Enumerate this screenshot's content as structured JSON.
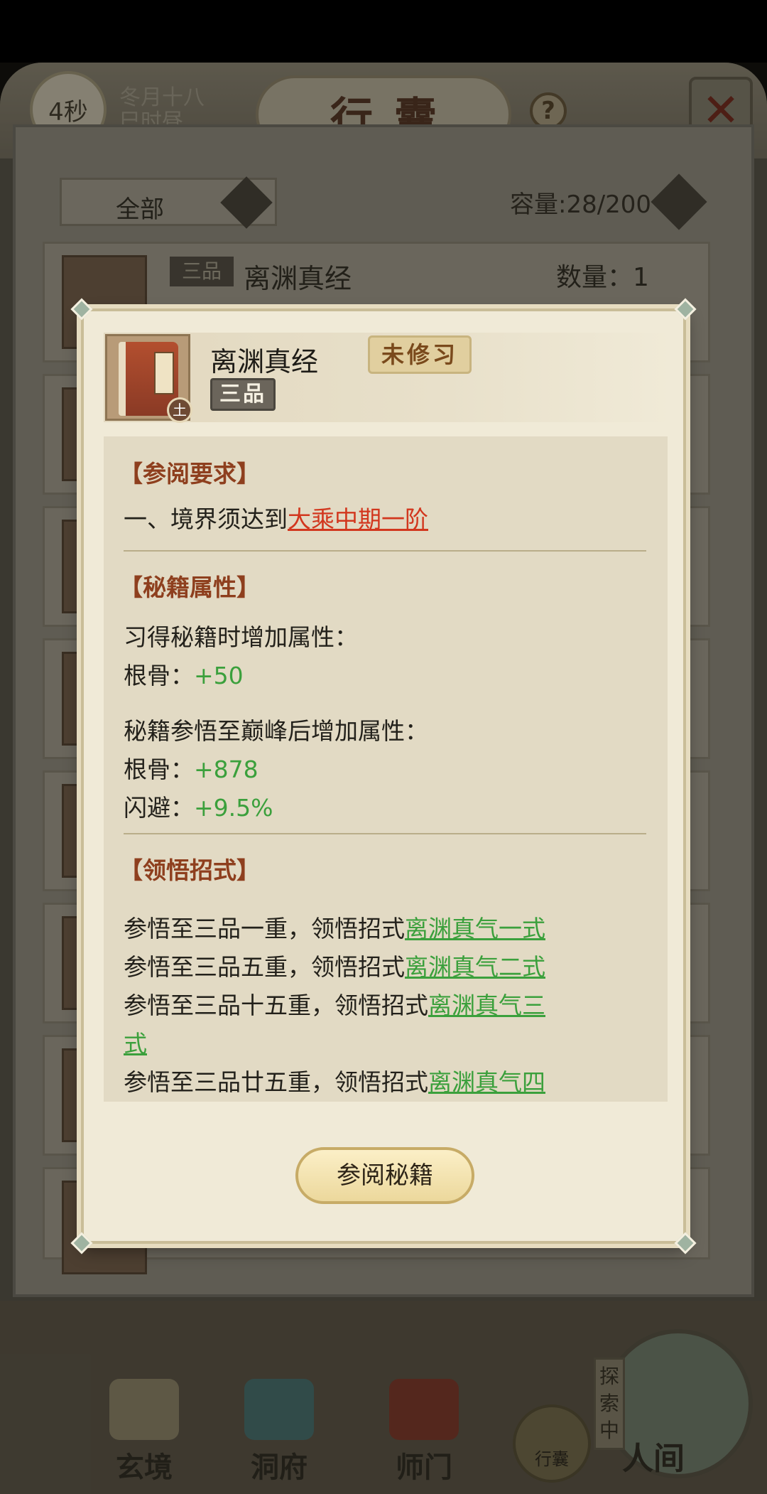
{
  "header": {
    "timer": "4秒",
    "date_line1": "冬月十八",
    "date_line2": "巳时昼",
    "title": "行囊",
    "help": "?",
    "progress": 0.55
  },
  "filter": {
    "selected": "全部"
  },
  "capacity": "容量:28/200",
  "list": {
    "first_item": {
      "grade": "三品",
      "name": "离渊真经",
      "quantity": "数量：1"
    }
  },
  "popup": {
    "item_name": "离渊真经",
    "status": "未修习",
    "grade": "三品",
    "element": "土",
    "requirements": {
      "title": "【参阅要求】",
      "line_prefix": "一、境界须达到",
      "line_link": "大乘中期一阶"
    },
    "attributes": {
      "title": "【秘籍属性】",
      "on_learn_label": "习得秘籍时增加属性：",
      "on_learn": [
        {
          "name": "根骨：",
          "value": "+50"
        }
      ],
      "on_peak_label": "秘籍参悟至巅峰后增加属性：",
      "on_peak": [
        {
          "name": "根骨：",
          "value": "+878"
        },
        {
          "name": "闪避：",
          "value": "+9.5%"
        }
      ]
    },
    "moves": {
      "title": "【领悟招式】",
      "items": [
        {
          "prefix": "参悟至三品一重，领悟招式",
          "move": "离渊真气一式"
        },
        {
          "prefix": "参悟至三品五重，领悟招式",
          "move": "离渊真气二式"
        },
        {
          "prefix": "参悟至三品十五重，领悟招式",
          "move": "离渊真气三",
          "move_cont": "式"
        },
        {
          "prefix": "参悟至三品廿五重，领悟招式",
          "move": "离渊真气四"
        }
      ]
    },
    "button": "参阅秘籍"
  },
  "nav": {
    "items": [
      "玄境",
      "洞府",
      "师门"
    ],
    "bag": "行囊",
    "explore": "探索中",
    "world": "人间"
  }
}
